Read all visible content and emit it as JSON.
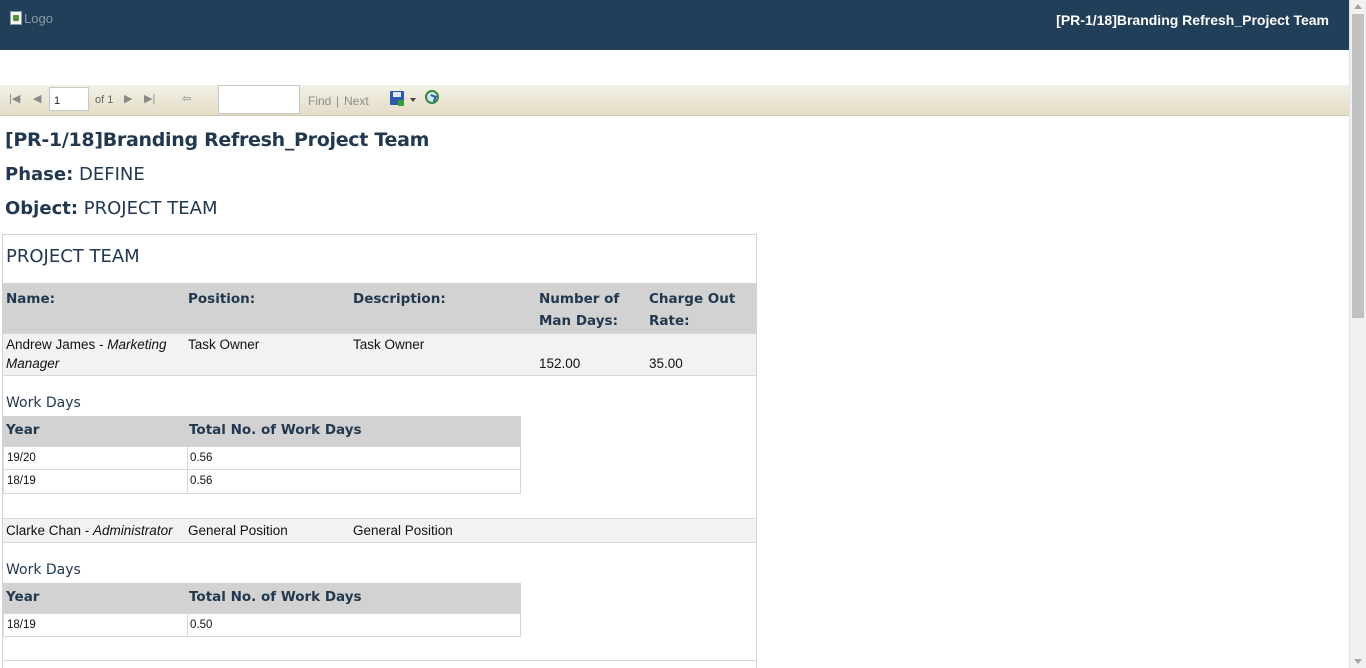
{
  "header": {
    "logo_alt": "Logo",
    "title": "[PR-1/18]Branding Refresh_Project Team"
  },
  "toolbar": {
    "current_page": "1",
    "of_total": "of 1",
    "find_label": "Find",
    "separator": "|",
    "next_label": "Next"
  },
  "report": {
    "title": "[PR-1/18]Branding Refresh_Project Team",
    "phase_label": "Phase:",
    "phase_value": "DEFINE",
    "object_label": "Object:",
    "object_value": "PROJECT TEAM"
  },
  "team": {
    "section_title": "PROJECT TEAM",
    "columns": {
      "name": "Name:",
      "position": "Position:",
      "description": "Description:",
      "man_days_1": "Number of",
      "man_days_2": "Man Days:",
      "rate_1": "Charge Out",
      "rate_2": "Rate:"
    },
    "members": [
      {
        "name": "Andrew James",
        "role_1": "Marketing",
        "role_2": "Manager",
        "position": "Task Owner",
        "description": "Task Owner",
        "man_days": "152.00",
        "rate": "35.00",
        "work_days_label": "Work Days",
        "work_days_header": {
          "year": "Year",
          "total": "Total No. of Work Days"
        },
        "work_days": [
          {
            "year": "19/20",
            "total": "0.56"
          },
          {
            "year": "18/19",
            "total": "0.56"
          }
        ]
      },
      {
        "name": "Clarke Chan",
        "role": "Administrator",
        "position": "General Position",
        "description": "General Position",
        "work_days_label": "Work Days",
        "work_days_header": {
          "year": "Year",
          "total": "Total No. of Work Days"
        },
        "work_days": [
          {
            "year": "18/19",
            "total": "0.50"
          }
        ]
      }
    ]
  }
}
